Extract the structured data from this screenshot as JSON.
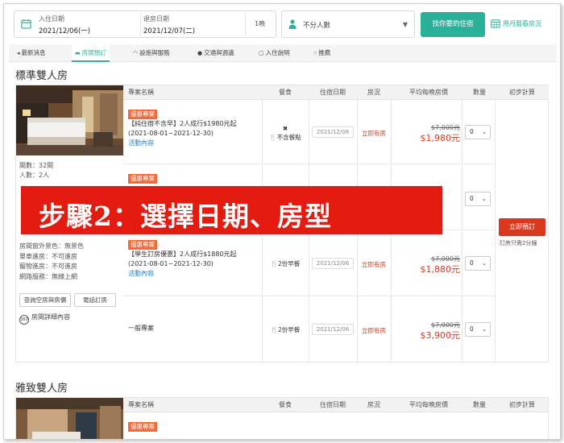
{
  "search": {
    "checkin_label": "入住日期",
    "checkin_value": "2021/12/06(一)",
    "checkout_label": "退房日期",
    "checkout_value": "2021/12/07(二)",
    "nights": "1晚",
    "guests": "不分人數",
    "find_button": "找你要的住宿",
    "month_link": "用月曆看房況"
  },
  "nav": [
    {
      "label": "最新消息"
    },
    {
      "label": "房間預訂"
    },
    {
      "label": "設施與服務"
    },
    {
      "label": "交通與週邊"
    },
    {
      "label": "入住說明"
    },
    {
      "label": "推薦"
    }
  ],
  "room1": {
    "title": "標準雙人房",
    "info": [
      "間數：32間",
      "人數：2人"
    ],
    "info2": [
      "房間窗外景色：無景色",
      "單車進房：不可進房",
      "寵物進房：不可進房",
      "網路服務：無線上網"
    ],
    "btn_query": "查詢空房與房價",
    "btn_phone": "電話訂房",
    "detail_link": "房間詳細內容",
    "headers": {
      "plan": "專案名稱",
      "meal": "餐食",
      "date": "住宿日期",
      "status": "房況",
      "price": "平均每晚房價",
      "qty": "數量",
      "calc": "初步計算"
    },
    "rows": [
      {
        "tag": "優惠專案",
        "name": "【純住宿不含早】2人成行$1980元起",
        "period": "(2021-08-01~2021-12-30)",
        "link": "活動內容",
        "meal_icon": "✖",
        "meal": "不含餐點",
        "date": "2021/12/06",
        "status": "立即有房",
        "old": "$7,000元",
        "new": "$1,980元",
        "qty": "0"
      },
      {
        "tag": "優惠專案",
        "qty": "0"
      },
      {
        "tag": "優惠專案",
        "name": "【學生訂房優惠】2人成行$1880元起",
        "period": "(2021-08-01~2021-12-30)",
        "link": "活動內容",
        "meal": "2份早餐",
        "date": "2021/12/06",
        "status": "立即有房",
        "old": "$7,000元",
        "new": "$1,880元",
        "qty": "0"
      },
      {
        "name": "一般專案",
        "meal": "2份早餐",
        "date": "2021/12/06",
        "status": "立即有房",
        "old": "$7,000元",
        "new": "$3,900元",
        "qty": "0"
      }
    ],
    "book_button": "立即預訂",
    "book_note": "訂房只需2分鐘"
  },
  "overlay": "步驟2：選擇日期、房型",
  "room2": {
    "title": "雅致雙人房",
    "headers": {
      "plan": "專案名稱",
      "meal": "餐食",
      "date": "住宿日期",
      "status": "房況",
      "price": "平均每晚房價",
      "qty": "數量",
      "calc": "初步計算"
    },
    "tag": "優惠專案"
  },
  "colors": {
    "accent": "#2bb19a",
    "promo": "#ef6b3a",
    "price_red": "#d9381e",
    "overlay": "#e41b10"
  }
}
